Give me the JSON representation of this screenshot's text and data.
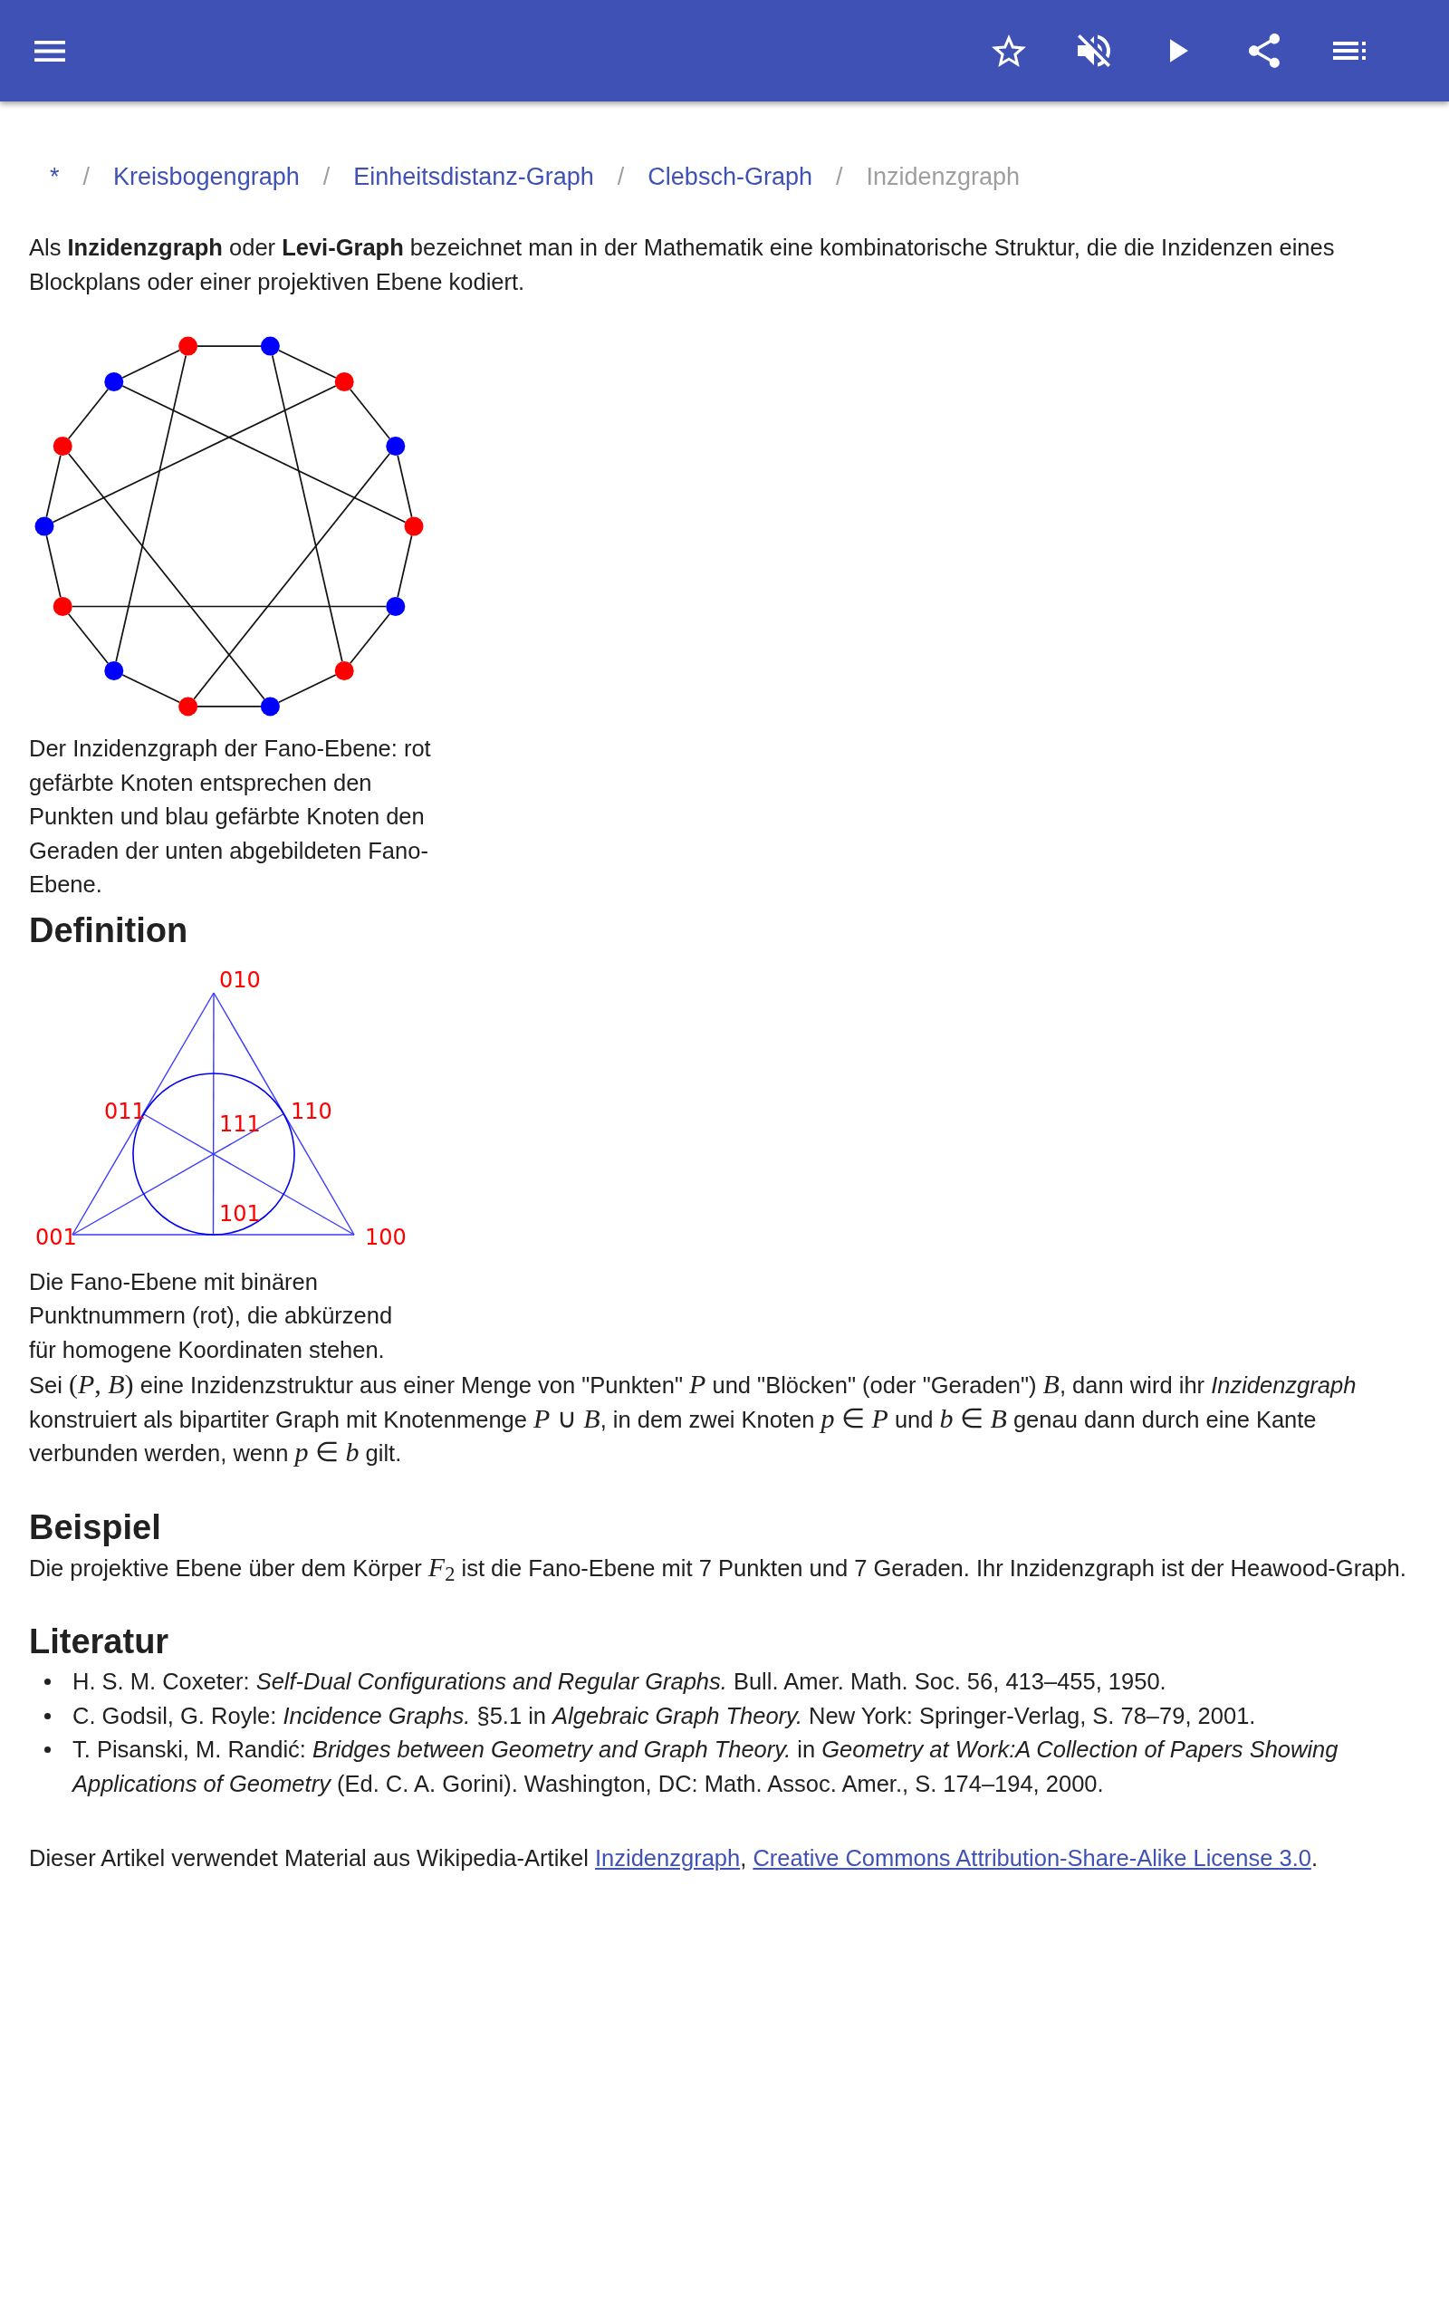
{
  "breadcrumb": [
    {
      "label": "*",
      "current": false
    },
    {
      "separator": "/",
      "label": "Kreisbogengraph",
      "current": false
    },
    {
      "separator": "/",
      "label": "Einheitsdistanz-Graph",
      "current": false
    },
    {
      "separator": "/",
      "label": "Clebsch-Graph",
      "current": false
    },
    {
      "separator": "/",
      "label": "Inzidenzgraph",
      "current": true
    }
  ],
  "intro": "Als **Inzidenzgraph** oder **Levi-Graph** bezeichnet man in der Mathematik eine kombinatorische Struktur, die die Inzidenzen eines Blockplans oder einer projektiven Ebene kodiert.",
  "graph_figure": {
    "vertices": [
      {
        "color": "#ff0000"
      },
      {
        "color": "#0000ff"
      },
      {
        "color": "#ff0000"
      },
      {
        "color": "#0000ff"
      },
      {
        "color": "#ff0000"
      },
      {
        "color": "#0000ff"
      },
      {
        "color": "#ff0000"
      },
      {
        "color": "#0000ff"
      },
      {
        "color": "#ff0000"
      },
      {
        "color": "#0000ff"
      },
      {
        "color": "#ff0000"
      },
      {
        "color": "#0000ff"
      },
      {
        "color": "#ff0000"
      },
      {
        "color": "#0000ff"
      }
    ],
    "caption": "Der Inzidenzgraph der Fano-Ebene: rot gefärbte Knoten entsprechen den Punkten und blau gefärbte Knoten den Geraden der unten abgebildeten Fano-Ebene."
  },
  "sections": [
    {
      "heading": "Definition",
      "figure": {
        "labels": [
          "010",
          "011",
          "111",
          "110",
          "101",
          "001",
          "100"
        ],
        "caption": "Die Fano-Ebene mit binären Punktnummern (rot), die abkürzend für homogene Koordinaten stehen."
      },
      "paragraph": [
        {
          "kind": "text",
          "text": "Sei "
        },
        {
          "kind": "math",
          "text": "(*P*, *B*)"
        },
        {
          "kind": "text",
          "text": " eine Inzidenzstruktur aus einer Menge von \"Punkten\" "
        },
        {
          "kind": "math",
          "text": "*P*"
        },
        {
          "kind": "text",
          "text": " und \"Blöcken\" (oder \"Geraden\") "
        },
        {
          "kind": "math",
          "text": "*B*"
        },
        {
          "kind": "text",
          "text": ", dann wird ihr *Inzidenzgraph* konstruiert als bipartiter Graph mit Knotenmenge "
        },
        {
          "kind": "math",
          "text": "*P* ∪ *B*"
        },
        {
          "kind": "text",
          "text": ", in dem zwei Knoten "
        },
        {
          "kind": "math",
          "text": "*p* ∈ *P*"
        },
        {
          "kind": "text",
          "text": " und "
        },
        {
          "kind": "math",
          "text": "*b* ∈ *B*"
        },
        {
          "kind": "text",
          "text": " genau dann durch eine Kante verbunden werden, wenn "
        },
        {
          "kind": "math",
          "text": "*p* ∈ *b*"
        },
        {
          "kind": "text",
          "text": " gilt."
        }
      ]
    },
    {
      "heading": "Beispiel",
      "paragraph": [
        {
          "kind": "text",
          "text": "Die projektive Ebene über dem Körper "
        },
        {
          "kind": "math",
          "text": "*F*$_{2}$"
        },
        {
          "kind": "text",
          "text": " ist die Fano-Ebene mit 7 Punkten und 7 Geraden. Ihr Inzidenzgraph ist der Heawood-Graph."
        }
      ]
    },
    {
      "heading": "Literatur",
      "references": [
        "H. S. M. Coxeter: *Self-Dual Configurations and Regular Graphs.* Bull. Amer. Math. Soc. 56, 413–455, 1950.",
        "C. Godsil, G. Royle: *Incidence Graphs.* §5.1 in *Algebraic Graph Theory.* New York: Springer-Verlag, S. 78–79, 2001.",
        "T. Pisanski, M. Randić: *Bridges between Geometry and Graph Theory.* in *Geometry at Work:A Collection of Papers Showing Applications of Geometry* (Ed. C. A. Gorini). Washington, DC: Math. Assoc. Amer., S. 174–194, 2000."
      ]
    }
  ],
  "footer": {
    "text": "Dieser Artikel verwendet Material aus Wikipedia-Artikel",
    "links": [
      {
        "text": "Inzidenzgraph",
        "punctuation": ","
      },
      {
        "text": "Creative Commons Attribution-Share-Alike License 3.0",
        "punctuation": "."
      }
    ]
  }
}
